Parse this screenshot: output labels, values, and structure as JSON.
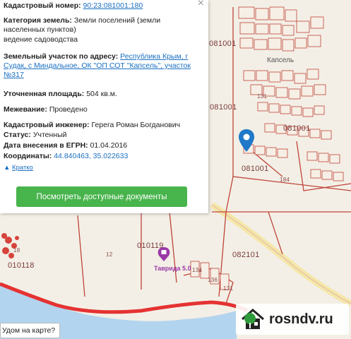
{
  "map": {
    "parcel_labels": [
      "081001",
      "081001",
      "081001",
      "081001",
      "082101",
      "010119",
      "010118"
    ],
    "lot_numbers": [
      "18",
      "12",
      "134",
      "136",
      "131",
      "184",
      "131"
    ],
    "town_label": "Капсель",
    "poi": {
      "name": "Таврида 5.0",
      "icon": "poi-marker-icon"
    },
    "prompt_bubble": "Удом на карте?",
    "colors": {
      "sea": "#b3d4ee",
      "road": "#e53232",
      "parcel": "#c0443a",
      "highway": "#f4e7a8",
      "marker": "#1f78c8"
    }
  },
  "card": {
    "close": "×",
    "cadastral_label": "Кадастровый номер:",
    "cadastral_value": "90:23:081001:180",
    "category_label": "Категория земель:",
    "category_value": "Земли поселений (земли населенных пунктов)",
    "usage_value": "ведение садоводства",
    "address_label": "Земельный участок по адресу:",
    "address_value": "Республика Крым, г Судак, с Миндальное, ОК \"ОП СОТ \"Капсель\", участок №317",
    "area_label": "Уточненная площадь:",
    "area_value": "504 кв.м.",
    "survey_label": "Межевание:",
    "survey_value": "Проведено",
    "engineer_label": "Кадастровый инженер:",
    "engineer_value": "Герега Роман Богданович",
    "status_label": "Статус:",
    "status_value": "Учтенный",
    "egrn_label": "Дата внесения в ЕГРН:",
    "egrn_value": "01.04.2016",
    "coords_label": "Координаты:",
    "coords_value": "44.840463, 35.022633",
    "collapse_label": "Кратко",
    "button_label": "Посмотреть доступные документы"
  },
  "watermark": {
    "text": "rosndv.ru",
    "icon": "house-logo-icon"
  }
}
